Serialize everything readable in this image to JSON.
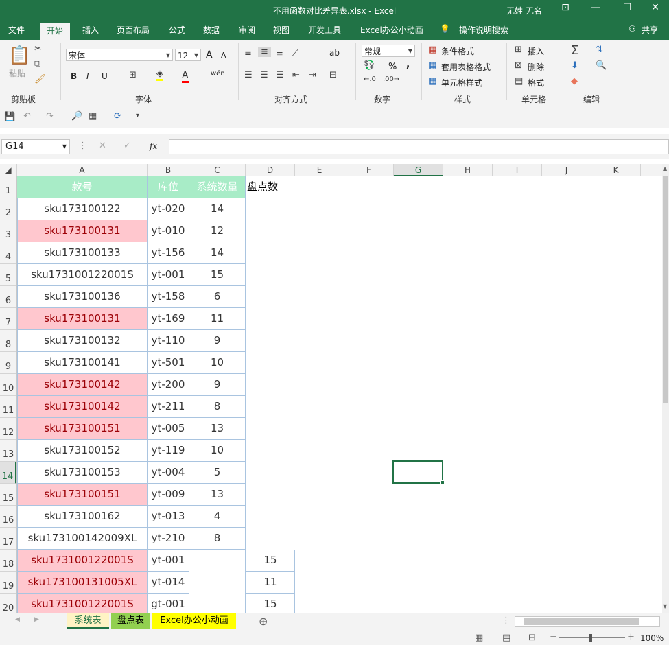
{
  "window": {
    "title": "不用函数对比差异表.xlsx  -  Excel",
    "user": "无姓 无名"
  },
  "ribbon_tabs": [
    "文件",
    "开始",
    "插入",
    "页面布局",
    "公式",
    "数据",
    "审阅",
    "视图",
    "开发工具",
    "Excel办公小动画",
    "操作说明搜索"
  ],
  "share_label": "共享",
  "ribbon": {
    "clipboard": {
      "paste_label": "粘贴",
      "group_label": "剪贴板"
    },
    "font": {
      "font_name": "宋体",
      "font_size": "12",
      "group_label": "字体",
      "bold": "B",
      "italic": "I",
      "underline": "U",
      "grow": "A",
      "shrink": "A",
      "color_letter": "A",
      "phonetic": "wén"
    },
    "alignment": {
      "group_label": "对齐方式",
      "wrap": "ab"
    },
    "number": {
      "format": "常规",
      "percent": "%",
      "comma": ",",
      "group_label": "数字"
    },
    "styles": {
      "conditional": "条件格式",
      "table": "套用表格格式",
      "cell_styles": "单元格样式",
      "group_label": "样式"
    },
    "cells": {
      "insert": "插入",
      "delete": "删除",
      "format": "格式",
      "group_label": "单元格"
    },
    "editing": {
      "group_label": "编辑"
    }
  },
  "formula_bar": {
    "name_box": "G14",
    "fx": "fx",
    "content": ""
  },
  "columns": [
    "A",
    "B",
    "C",
    "D",
    "E",
    "F",
    "G",
    "H",
    "I",
    "J",
    "K"
  ],
  "selected_column": "G",
  "rows": [
    "1",
    "2",
    "3",
    "4",
    "5",
    "6",
    "7",
    "8",
    "9",
    "10",
    "11",
    "12",
    "13",
    "14",
    "15",
    "16",
    "17",
    "18",
    "19",
    "20"
  ],
  "selected_row": "14",
  "header_row": {
    "a": "款号",
    "b": "库位",
    "c": "系统数量",
    "d": "盘点数"
  },
  "data_rows": [
    {
      "a": "sku173100122",
      "b": "yt-020",
      "c": "14",
      "d": "",
      "pink": false
    },
    {
      "a": "sku173100131",
      "b": "yt-010",
      "c": "12",
      "d": "",
      "pink": true
    },
    {
      "a": "sku173100133",
      "b": "yt-156",
      "c": "14",
      "d": "",
      "pink": false
    },
    {
      "a": "sku173100122001S",
      "b": "yt-001",
      "c": "15",
      "d": "",
      "pink": false
    },
    {
      "a": "sku173100136",
      "b": "yt-158",
      "c": "6",
      "d": "",
      "pink": false
    },
    {
      "a": "sku173100131",
      "b": "yt-169",
      "c": "11",
      "d": "",
      "pink": true
    },
    {
      "a": "sku173100132",
      "b": "yt-110",
      "c": "9",
      "d": "",
      "pink": false
    },
    {
      "a": "sku173100141",
      "b": "yt-501",
      "c": "10",
      "d": "",
      "pink": false
    },
    {
      "a": "sku173100142",
      "b": "yt-200",
      "c": "9",
      "d": "",
      "pink": true
    },
    {
      "a": "sku173100142",
      "b": "yt-211",
      "c": "8",
      "d": "",
      "pink": true
    },
    {
      "a": "sku173100151",
      "b": "yt-005",
      "c": "13",
      "d": "",
      "pink": true
    },
    {
      "a": "sku173100152",
      "b": "yt-119",
      "c": "10",
      "d": "",
      "pink": false
    },
    {
      "a": "sku173100153",
      "b": "yt-004",
      "c": "5",
      "d": "",
      "pink": false
    },
    {
      "a": "sku173100151",
      "b": "yt-009",
      "c": "13",
      "d": "",
      "pink": true
    },
    {
      "a": "sku173100162",
      "b": "yt-013",
      "c": "4",
      "d": "",
      "pink": false
    },
    {
      "a": "sku173100142009XL",
      "b": "yt-210",
      "c": "8",
      "d": "",
      "pink": false
    },
    {
      "a": "sku173100122001S",
      "b": "yt-001",
      "c": "",
      "d": "15",
      "pink": true
    },
    {
      "a": "sku173100131005XL",
      "b": "yt-014",
      "c": "",
      "d": "11",
      "pink": true
    },
    {
      "a": "sku173100122001S",
      "b": "gt-001",
      "c": "",
      "d": "15",
      "pink": true
    }
  ],
  "sheet_tabs": [
    "系统表",
    "盘点表",
    "Excel办公小动画"
  ],
  "status": {
    "zoom": "100%"
  },
  "colors": {
    "excel_green": "#217346",
    "header_fill": "#a8ecc7",
    "pink_fill": "#ffc7ce",
    "pink_text": "#9c0006"
  }
}
